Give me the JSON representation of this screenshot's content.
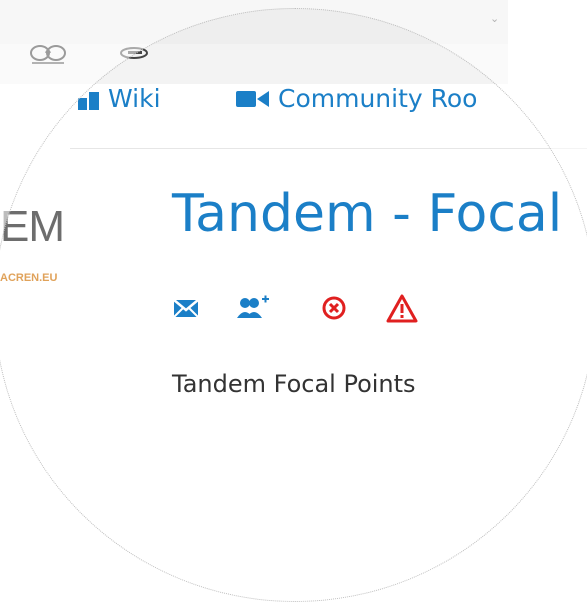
{
  "top_bar": {
    "dropdown_icon": "chevron-down-icon"
  },
  "partner_logos": [
    "partner-logo-1",
    "partner-logo-2"
  ],
  "nav": {
    "items": [
      {
        "label": "Wiki",
        "icon": "wiki-icon"
      },
      {
        "label": "Community Roo",
        "icon": "video-camera-icon"
      }
    ]
  },
  "site_logo": {
    "letters": "EM",
    "url_text": "ACREN.EU"
  },
  "page": {
    "title": "Tandem - Focal",
    "description": "Tandem Focal Points",
    "actions": [
      {
        "icon": "envelope-icon",
        "color": "#1b7fc7"
      },
      {
        "icon": "add-user-icon",
        "color": "#1b7fc7"
      },
      {
        "icon": "cancel-circle-icon",
        "color": "#e02020"
      },
      {
        "icon": "warning-icon",
        "color": "#e02020"
      }
    ]
  },
  "colors": {
    "link": "#1b7fc7",
    "danger": "#e02020",
    "text": "#333333"
  }
}
